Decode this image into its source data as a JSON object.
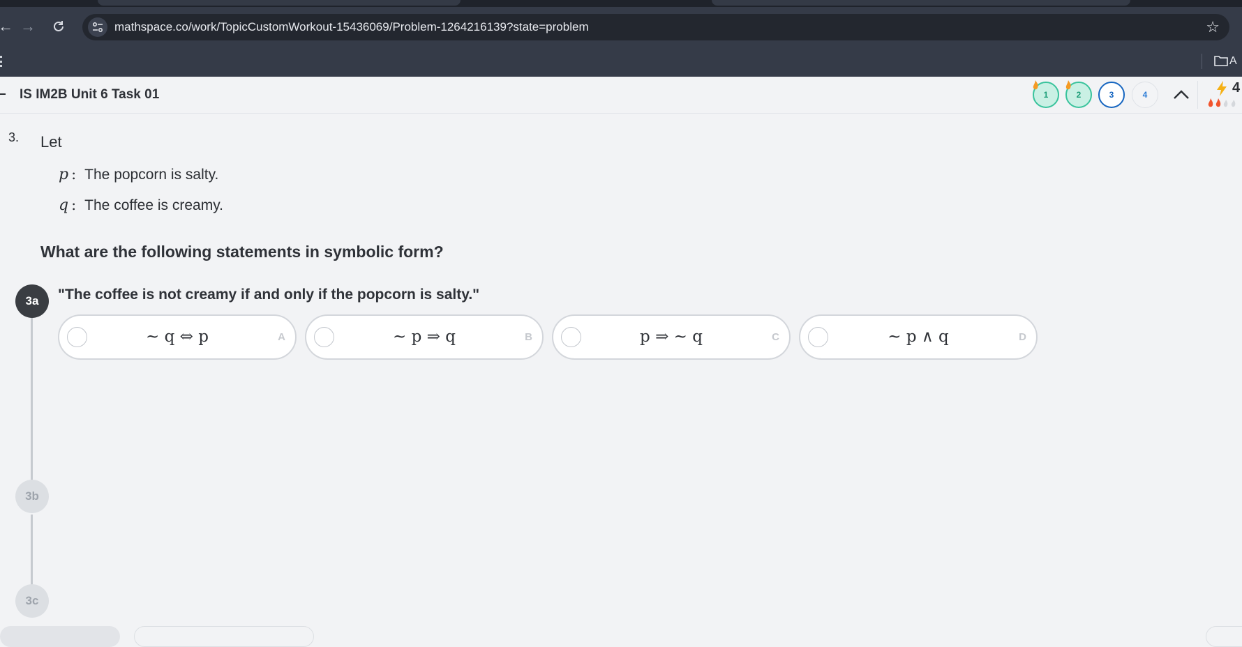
{
  "browser": {
    "url": "mathspace.co/work/TopicCustomWorkout-15436069/Problem-1264216139?state=problem",
    "back_icon": "arrow-left-icon",
    "forward_icon": "arrow-right-icon",
    "reload_icon": "reload-icon",
    "bookmark_star_icon": "star-icon",
    "bookmarks_bar_partial_label": "A"
  },
  "header": {
    "title": "IS IM2B Unit 6 Task 01",
    "question_nav": [
      {
        "label": "1",
        "state": "completed"
      },
      {
        "label": "2",
        "state": "completed"
      },
      {
        "label": "3",
        "state": "current"
      },
      {
        "label": "4",
        "state": "todo"
      }
    ],
    "streak_partial": "4"
  },
  "problem": {
    "number": "3.",
    "intro": "Let",
    "definitions": [
      {
        "var": "p",
        "text": "The popcorn is salty."
      },
      {
        "var": "q",
        "text": "The coffee is creamy."
      }
    ],
    "prompt": "What are the following statements in symbolic form?"
  },
  "subquestions": [
    {
      "label": "3a",
      "state": "active"
    },
    {
      "label": "3b",
      "state": "inactive"
    },
    {
      "label": "3c",
      "state": "inactive"
    }
  ],
  "active_subquestion": {
    "statement": "\"The coffee is not creamy if and only if the popcorn is salty.\"",
    "choices": [
      {
        "math": "~ q ⇔ p",
        "letter": "A"
      },
      {
        "math": "~ p ⇒ q",
        "letter": "B"
      },
      {
        "math": "p ⇒ ~ q",
        "letter": "C"
      },
      {
        "math": "~ p ∧ q",
        "letter": "D"
      }
    ]
  },
  "colors": {
    "chrome_dark": "#353b48",
    "omnibox": "#23272f",
    "page_bg": "#f2f3f5",
    "completed_teal": "#39c39c",
    "current_blue": "#1565c0",
    "active_step": "#3a3d42"
  }
}
